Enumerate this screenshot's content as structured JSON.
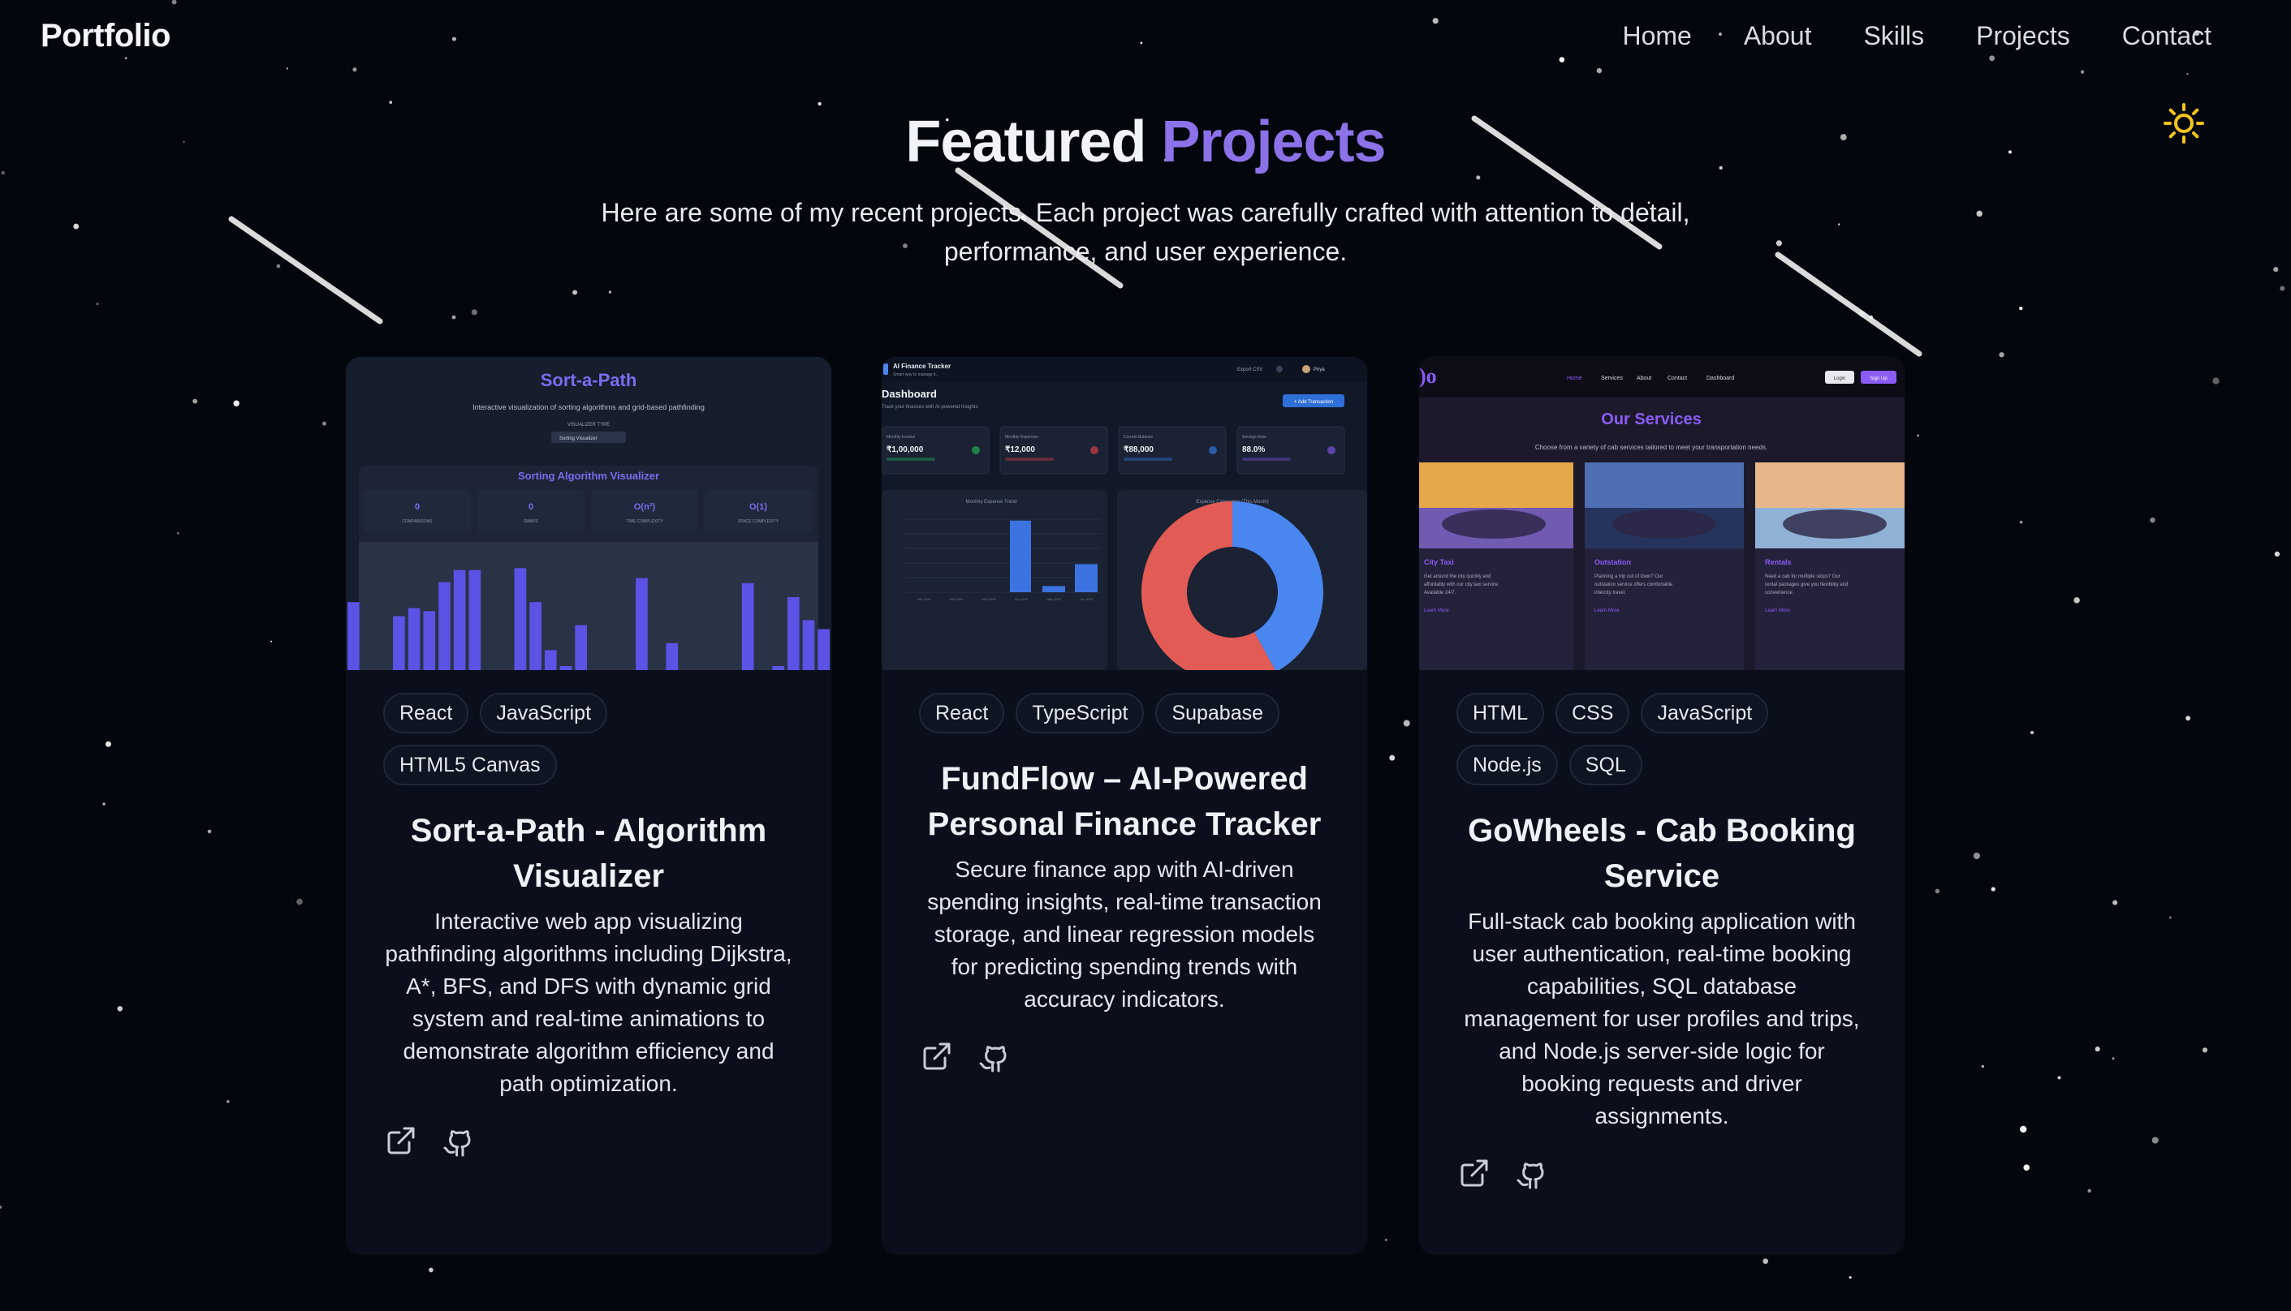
{
  "nav": {
    "logo": "Portfolio",
    "links": [
      "Home",
      "About",
      "Skills",
      "Projects",
      "Contact"
    ]
  },
  "theme_toggle": {
    "icon": "sun-icon",
    "color": "#f5c518"
  },
  "hero": {
    "title_part1": "Featured",
    "title_part2": "Projects",
    "subtitle": "Here are some of my recent projects. Each project was carefully crafted with attention to detail, performance, and user experience."
  },
  "colors": {
    "accent": "#8b72e8",
    "background": "#03060c",
    "card": "#0a0f1b"
  },
  "projects": [
    {
      "title": "Sort-a-Path - Algorithm Visualizer",
      "tags": [
        "React",
        "JavaScript",
        "HTML5 Canvas"
      ],
      "description": "Interactive web app visualizing pathfinding algorithms including Dijkstra, A*, BFS, and DFS with dynamic grid system and real-time animations to demonstrate algorithm efficiency and path optimization.",
      "preview": {
        "title": "Sort-a-Path",
        "subtitle": "Interactive visualization of sorting algorithms and grid-based pathfinding",
        "visualizer_type_label": "VISUALIZER TYPE",
        "select_value": "Sorting Visualizer",
        "panel_title": "Sorting Algorithm Visualizer",
        "stats": [
          {
            "value": "0",
            "label": "COMPARISONS"
          },
          {
            "value": "0",
            "label": "SWAPS"
          },
          {
            "value": "O(n²)",
            "label": "TIME COMPLEXITY"
          },
          {
            "value": "O(1)",
            "label": "SPACE COMPLEXITY"
          }
        ],
        "bars": [
          0.68,
          0,
          0,
          0.54,
          0.62,
          0.59,
          0.88,
          1.0,
          1.0,
          0,
          0,
          1.02,
          0.68,
          0.2,
          0.04,
          0.45,
          0,
          0,
          0,
          0.92,
          0,
          0.27,
          0,
          0,
          0,
          0,
          0.87,
          0,
          0.04,
          0.73,
          0.5,
          0.41
        ]
      },
      "links": [
        "external-link-icon",
        "github-icon"
      ]
    },
    {
      "title": "FundFlow – AI-Powered Personal Finance Tracker",
      "tags": [
        "React",
        "TypeScript",
        "Supabase"
      ],
      "description": "Secure finance app with AI-driven spending insights, real-time transaction storage, and linear regression models for predicting spending trends with accuracy indicators.",
      "preview": {
        "app_name": "AI Finance Tracker",
        "app_tag": "Smart way to manage it...",
        "export_label": "Export CSV",
        "user": "Priya",
        "heading": "Dashboard",
        "heading_sub": "Track your finances with AI-powered insights",
        "add_button": "+ Add Transaction",
        "stats": [
          {
            "label": "Monthly Income",
            "value": "₹1,00,000"
          },
          {
            "label": "Monthly Expenses",
            "value": "₹12,000"
          },
          {
            "label": "Current Balance",
            "value": "₹88,000"
          },
          {
            "label": "Savings Rate",
            "value": "88.0%"
          }
        ],
        "trend_title": "Monthly Expense Trend",
        "trend_values": [
          0,
          0,
          0,
          0.92,
          0.08,
          0.36
        ],
        "trend_months": [
          "Jan 2025",
          "Feb 2025",
          "Mar 2025",
          "Apr 2025",
          "May 2025",
          "Jun 2025"
        ],
        "donut_title": "Expense Categories (This Month)",
        "donut_split": [
          0.42,
          0.58
        ],
        "donut_colors": [
          "#4a86f0",
          "#e25b55"
        ]
      },
      "links": [
        "external-link-icon",
        "github-icon"
      ]
    },
    {
      "title": "GoWheels - Cab Booking Service",
      "tags": [
        "HTML",
        "CSS",
        "JavaScript",
        "Node.js",
        "SQL"
      ],
      "description": "Full-stack cab booking application with user authentication, real-time booking capabilities, SQL database management for user profiles and trips, and Node.js server-side logic for booking requests and driver assignments.",
      "preview": {
        "nav": [
          "Home",
          "Services",
          "About",
          "Contact",
          "Dashboard"
        ],
        "login": "Login",
        "signup": "Sign Up",
        "heading": "Our Services",
        "sub": "Choose from a variety of cab services tailored to meet your transportation needs.",
        "services": [
          {
            "name": "City Taxi",
            "text": "Get around the city quickly and affordably with our city taxi service. Available 24/7.",
            "cta": "Learn More"
          },
          {
            "name": "Outstation",
            "text": "Planning a trip out of town? Our outstation service offers comfortable intercity travel.",
            "cta": "Learn More"
          },
          {
            "name": "Rentals",
            "text": "Need a cab for multiple stops? Our rental packages give you flexibility and convenience.",
            "cta": "Learn More"
          }
        ]
      },
      "links": [
        "external-link-icon",
        "github-icon"
      ]
    }
  ]
}
